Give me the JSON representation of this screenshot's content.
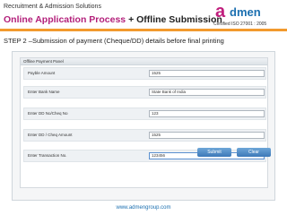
{
  "header": {
    "top_label": "Recruitment & Admission Solutions",
    "headline_part1": "Online Application Process",
    "headline_part2": " + Offline Submission",
    "logo_a": "a",
    "logo_rest": "dmen",
    "cert": "Certified ISO 27001 : 2005",
    "colors": {
      "accent_magenta": "#b31f7a",
      "logo_blue": "#1b6fb0",
      "rule_orange": "#f29a2e"
    }
  },
  "step_text": "STEP 2 –Submission of payment (Cheque/DD) details before final printing",
  "panel": {
    "title": "Offline Payment Panel",
    "rows": [
      {
        "label": "Payble Amount",
        "value": "1525"
      },
      {
        "label": "Enter Bank Name",
        "value": "State Bank of India"
      },
      {
        "label": "Enter DD No/Cheq No",
        "value": "123"
      },
      {
        "label": "Enter DD / Cheq Amount",
        "value": "1525"
      },
      {
        "label": "Enter Transaction No.",
        "value": "123456"
      }
    ],
    "submit_label": "Submit",
    "clear_label": "Clear"
  },
  "footer": {
    "url": "www.admengroup.com"
  }
}
